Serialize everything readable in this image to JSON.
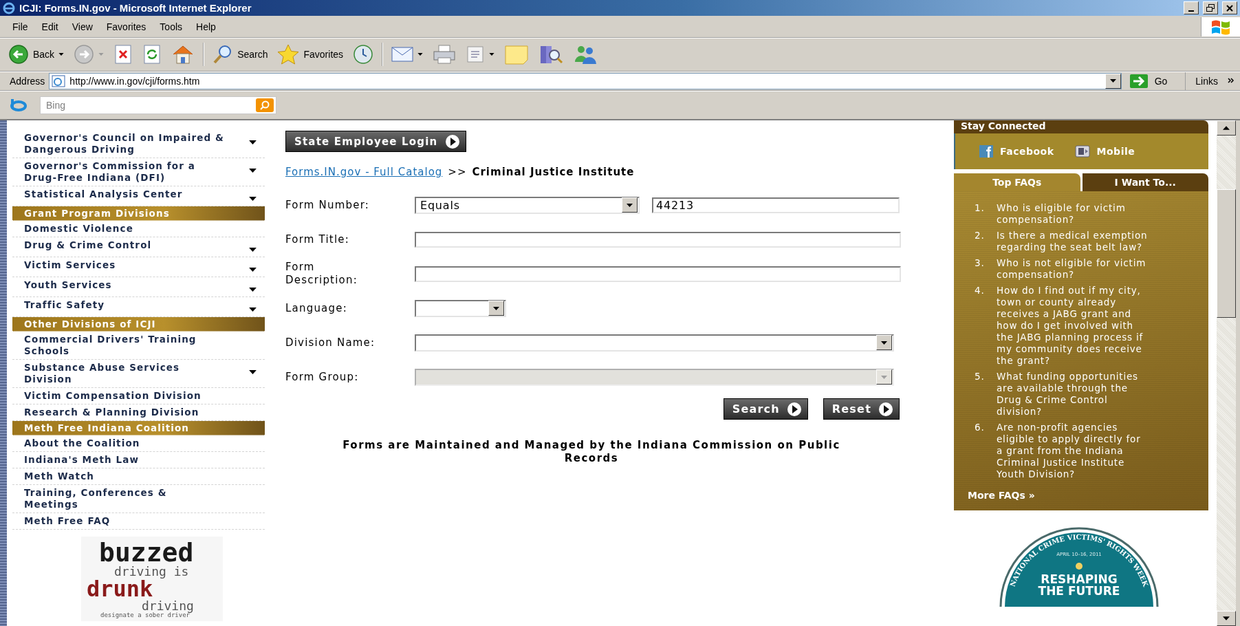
{
  "window": {
    "title": "ICJI: Forms.IN.gov - Microsoft Internet Explorer"
  },
  "menu": [
    "File",
    "Edit",
    "View",
    "Favorites",
    "Tools",
    "Help"
  ],
  "toolbar": [
    {
      "kind": "back",
      "label": "Back",
      "dropdown": true
    },
    {
      "kind": "forward",
      "dropdown": true
    },
    {
      "kind": "stop",
      "dropdown": false
    },
    {
      "kind": "refresh",
      "dropdown": false
    },
    {
      "kind": "home",
      "dropdown": false
    },
    {
      "kind": "separator"
    },
    {
      "kind": "search",
      "label": "Search",
      "dropdown": false
    },
    {
      "kind": "favorites",
      "label": "Favorites",
      "dropdown": false
    },
    {
      "kind": "history",
      "dropdown": false
    },
    {
      "kind": "separator"
    },
    {
      "kind": "mail",
      "dropdown": true
    },
    {
      "kind": "print",
      "dropdown": false
    },
    {
      "kind": "edit",
      "dropdown": true
    },
    {
      "kind": "notes",
      "dropdown": false
    },
    {
      "kind": "research",
      "dropdown": false
    },
    {
      "kind": "messenger",
      "dropdown": false
    }
  ],
  "address_bar": {
    "label": "Address",
    "url": "http://www.in.gov/cji/forms.htm",
    "go": "Go",
    "links": "Links"
  },
  "search_bar": {
    "placeholder": "Bing"
  },
  "sidebar": {
    "items": [
      {
        "kind": "link",
        "label": "Governor's Council on Impaired & Dangerous Driving",
        "expandable": true
      },
      {
        "kind": "link",
        "label": "Governor's Commission for a Drug-Free Indiana (DFI)",
        "expandable": true
      },
      {
        "kind": "link",
        "label": "Statistical Analysis Center",
        "expandable": true
      },
      {
        "kind": "heading",
        "label": "Grant Program Divisions"
      },
      {
        "kind": "link",
        "label": "Domestic Violence",
        "expandable": false
      },
      {
        "kind": "link",
        "label": "Drug & Crime Control",
        "expandable": true
      },
      {
        "kind": "link",
        "label": "Victim Services",
        "expandable": true
      },
      {
        "kind": "link",
        "label": "Youth Services",
        "expandable": true
      },
      {
        "kind": "link",
        "label": "Traffic Safety",
        "expandable": true
      },
      {
        "kind": "heading",
        "label": "Other Divisions of ICJI"
      },
      {
        "kind": "link",
        "label": "Commercial Drivers' Training Schools",
        "expandable": false
      },
      {
        "kind": "link",
        "label": "Substance Abuse Services Division",
        "expandable": true
      },
      {
        "kind": "link",
        "label": "Victim Compensation Division",
        "expandable": false
      },
      {
        "kind": "link",
        "label": "Research & Planning Division",
        "expandable": false
      },
      {
        "kind": "heading",
        "label": "Meth Free Indiana Coalition"
      },
      {
        "kind": "link",
        "label": "About the Coalition",
        "expandable": false
      },
      {
        "kind": "link",
        "label": "Indiana's Meth Law",
        "expandable": false
      },
      {
        "kind": "link",
        "label": "Meth Watch",
        "expandable": false
      },
      {
        "kind": "link",
        "label": "Training, Conferences & Meetings",
        "expandable": false
      },
      {
        "kind": "link",
        "label": "Meth Free FAQ",
        "expandable": false
      }
    ]
  },
  "buzzed_logo": {
    "line_1": "buzzed",
    "line_2": "driving is",
    "line_3": "drunk",
    "line_4": "driving",
    "tagline": "designate a sober driver"
  },
  "login_button": "State Employee Login",
  "breadcrumb": {
    "link": "Forms.IN.gov - Full Catalog",
    "separator": ">>",
    "current": "Criminal Justice Institute"
  },
  "form": {
    "fields": [
      {
        "label": "Form Number:",
        "kind": "operator",
        "operator": "Equals",
        "value": "44213",
        "disabled": false
      },
      {
        "label": "Form Title:",
        "kind": "text",
        "disabled": false
      },
      {
        "label": "Form Description:",
        "kind": "text",
        "disabled": false
      },
      {
        "label": "Language:",
        "kind": "short-select",
        "disabled": false
      },
      {
        "label": "Division Name:",
        "kind": "select",
        "disabled": false
      },
      {
        "label": "Form Group:",
        "kind": "select",
        "disabled": true
      }
    ],
    "buttons": [
      "Search",
      "Reset"
    ]
  },
  "note": "Forms are Maintained and Managed by the Indiana Commission on Public Records",
  "stay_connected": {
    "title": "Stay Connected",
    "links": [
      {
        "kind": "facebook",
        "label": "Facebook"
      },
      {
        "kind": "mobile",
        "label": "Mobile"
      }
    ]
  },
  "faq_tabs": [
    {
      "label": "Top FAQs",
      "selected": true
    },
    {
      "label": "I Want To...",
      "selected": false
    }
  ],
  "faqs": [
    {
      "number": "1.",
      "text": "Who is eligible for victim compensation?"
    },
    {
      "number": "2.",
      "text": "Is there a medical exemption regarding the seat belt law?"
    },
    {
      "number": "3.",
      "text": "Who is not eligible for victim compensation?"
    },
    {
      "number": "4.",
      "text": "How do I find out if my city, town or county already receives a JABG grant and how do I get involved with the JABG planning process if my community does receive the grant?"
    },
    {
      "number": "5.",
      "text": "What funding opportunities are available through the Drug & Crime Control division?"
    },
    {
      "number": "6.",
      "text": "Are non-profit agencies eligible to apply directly for a grant from the Indiana Criminal Justice Institute Youth Division?"
    }
  ],
  "more_faqs": "More FAQs »",
  "badge": {
    "arc": "NATIONAL CRIME VICTIMS' RIGHTS WEEK",
    "dates": "APRIL 10–16, 2011",
    "title_1": "RESHAPING",
    "title_2": "THE FUTURE"
  }
}
